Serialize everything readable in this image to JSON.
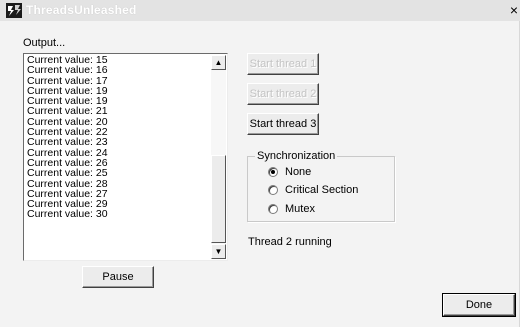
{
  "window": {
    "title": "ThreadsUnleashed",
    "close_glyph": "×",
    "icon": "app-icon"
  },
  "output": {
    "label": "Output...",
    "items": [
      "Current value: 15",
      "Current value: 16",
      "Current value: 17",
      "Current value: 19",
      "Current value: 19",
      "Current value: 21",
      "Current value: 20",
      "Current value: 22",
      "Current value: 23",
      "Current value: 24",
      "Current value: 26",
      "Current value: 25",
      "Current value: 28",
      "Current value: 27",
      "Current value: 29",
      "Current value: 30"
    ],
    "scroll_up_glyph": "▲",
    "scroll_down_glyph": "▼"
  },
  "buttons": {
    "pause": "Pause",
    "start1": "Start thread 1",
    "start2": "Start thread 2",
    "start3": "Start thread 3",
    "done": "Done"
  },
  "sync": {
    "label": "Synchronization",
    "options": [
      "None",
      "Critical Section",
      "Mutex"
    ],
    "selected": "None"
  },
  "status": "Thread 2 running"
}
